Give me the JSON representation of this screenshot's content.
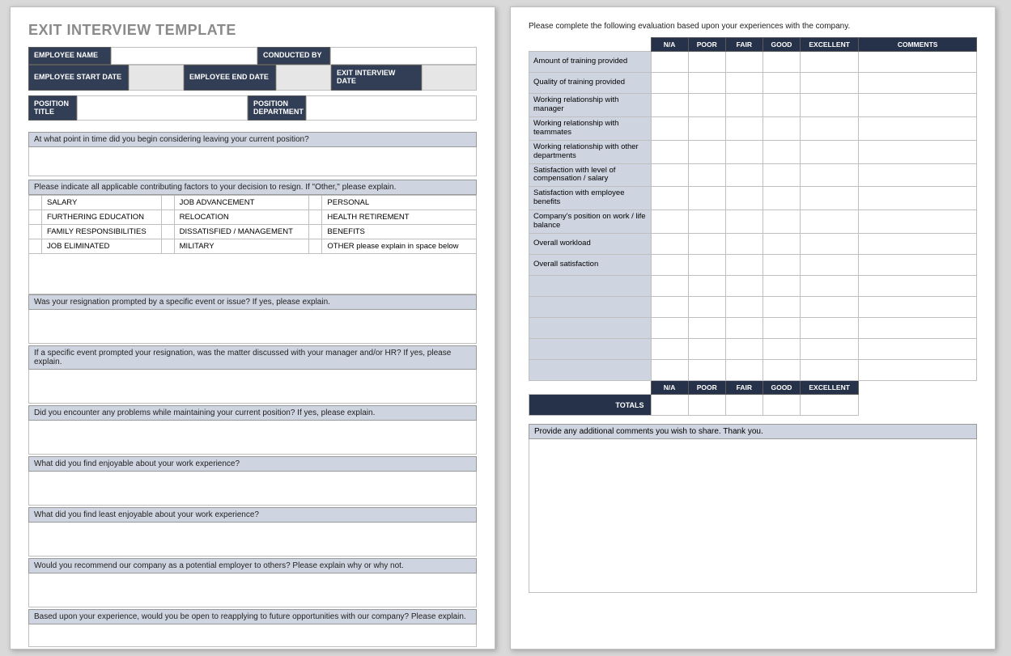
{
  "title": "EXIT INTERVIEW TEMPLATE",
  "header": {
    "employee_name": "EMPLOYEE NAME",
    "conducted_by": "CONDUCTED BY",
    "start_date": "EMPLOYEE START DATE",
    "end_date": "EMPLOYEE END DATE",
    "interview_date": "EXIT INTERVIEW DATE",
    "position_title": "POSITION TITLE",
    "position_department": "POSITION DEPARTMENT"
  },
  "questions": {
    "q1": "At what point in time did you begin considering leaving your current position?",
    "q2": "Please indicate all applicable contributing factors to your decision to resign. If \"Other,\" please explain.",
    "q3": "Was your resignation prompted by a specific event or issue? If yes, please explain.",
    "q4": "If a specific event prompted your resignation, was the matter discussed with your manager and/or HR? If yes, please explain.",
    "q5": "Did you encounter any problems while maintaining your current position?  If yes, please explain.",
    "q6": "What did you find enjoyable about your work experience?",
    "q7": "What did you find least enjoyable about your work experience?",
    "q8": "Would you recommend our company as a potential employer to others? Please explain why or why not.",
    "q9": "Based upon your experience, would you be open to reapplying to future opportunities with our company?  Please explain."
  },
  "factors": [
    [
      "SALARY",
      "JOB ADVANCEMENT",
      "PERSONAL"
    ],
    [
      "FURTHERING EDUCATION",
      "RELOCATION",
      "HEALTH RETIREMENT"
    ],
    [
      "FAMILY RESPONSIBILITIES",
      "DISSATISFIED / MANAGEMENT",
      "BENEFITS"
    ],
    [
      "JOB ELIMINATED",
      "MILITARY",
      "OTHER please explain in space below"
    ]
  ],
  "page2": {
    "instruction": "Please complete the following evaluation based upon your experiences with the company.",
    "cols": [
      "N/A",
      "POOR",
      "FAIR",
      "GOOD",
      "EXCELLENT",
      "COMMENTS"
    ],
    "rows": [
      "Amount of training provided",
      "Quality of training provided",
      "Working relationship with manager",
      "Working relationship with teammates",
      "Working relationship with other departments",
      "Satisfaction with level of compensation / salary",
      "Satisfaction with employee benefits",
      "Company's position on work / life balance",
      "Overall workload",
      "Overall satisfaction"
    ],
    "blank_rows": 5,
    "totals_label": "TOTALS",
    "totals_cols": [
      "N/A",
      "POOR",
      "FAIR",
      "GOOD",
      "EXCELLENT"
    ],
    "comment_prompt": "Provide any additional comments you wish to share.  Thank you."
  }
}
